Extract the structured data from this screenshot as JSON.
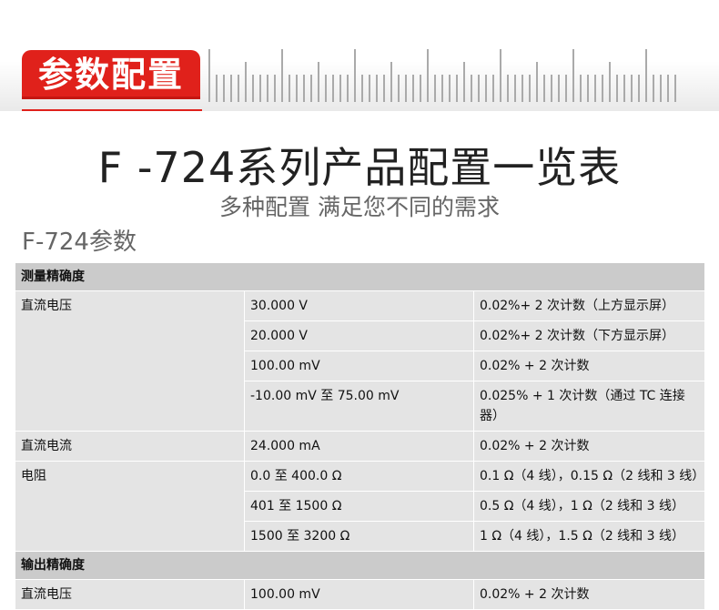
{
  "header": {
    "badge": "参数配置",
    "title": "F -724系列产品配置一览表",
    "subtitle": "多种配置 满足您不同的需求",
    "params_label": "F-724参数"
  },
  "colors": {
    "accent": "#e0211b",
    "section_bg": "#cbcbcb",
    "cell_bg": "#e4e4e4"
  },
  "table": {
    "sections": [
      {
        "title": "测量精确度",
        "groups": [
          {
            "name": "直流电压",
            "rows": [
              {
                "range": "30.000 V",
                "accuracy": "0.02%+ 2 次计数（上方显示屏）"
              },
              {
                "range": "20.000 V",
                "accuracy": "0.02%+ 2 次计数（下方显示屏）"
              },
              {
                "range": "100.00 mV",
                "accuracy": "0.02% + 2 次计数"
              },
              {
                "range": "-10.00 mV 至 75.00 mV",
                "accuracy": "0.025% + 1 次计数（通过 TC 连接器）"
              }
            ]
          },
          {
            "name": "直流电流",
            "rows": [
              {
                "range": "24.000 mA",
                "accuracy": "0.02% + 2 次计数"
              }
            ]
          },
          {
            "name": "电阻",
            "rows": [
              {
                "range": "0.0 至 400.0 Ω",
                "accuracy": "0.1 Ω（4 线），0.15 Ω（2 线和 3 线）"
              },
              {
                "range": "401 至 1500 Ω",
                "accuracy": "0.5 Ω（4 线），1 Ω（2 线和 3 线）"
              },
              {
                "range": "1500 至 3200 Ω",
                "accuracy": "1 Ω（4 线），1.5 Ω（2 线和 3 线）"
              }
            ]
          }
        ]
      },
      {
        "title": "输出精确度",
        "groups": [
          {
            "name": "直流电压",
            "rows": [
              {
                "range": "100.00 mV",
                "accuracy": "0.02% + 2 次计数"
              }
            ]
          }
        ]
      }
    ]
  }
}
